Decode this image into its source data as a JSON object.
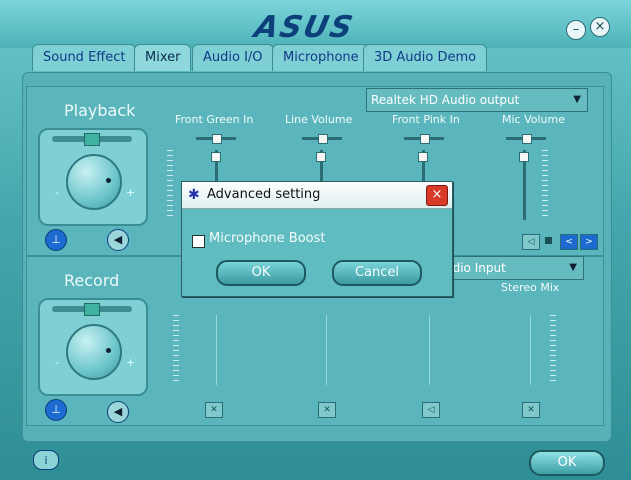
{
  "app": {
    "brand": "ASUS",
    "accent": "#0d3f7a"
  },
  "window_controls": {
    "minimize": "–",
    "close": "×"
  },
  "tabs": [
    {
      "label": "Sound Effect"
    },
    {
      "label": "Mixer"
    },
    {
      "label": "Audio I/O"
    },
    {
      "label": "Microphone"
    },
    {
      "label": "3D Audio Demo"
    }
  ],
  "active_tab": "Mixer",
  "playback": {
    "title": "Playback",
    "minus": "-",
    "plus": "+",
    "device": "Realtek HD Audio output",
    "channels": [
      {
        "label": "Front Green In"
      },
      {
        "label": "Line Volume"
      },
      {
        "label": "Front Pink In"
      },
      {
        "label": "Mic Volume"
      }
    ]
  },
  "record": {
    "title": "Record",
    "minus": "-",
    "plus": "+",
    "device": "udio Input",
    "sublabel": "Stereo Mix"
  },
  "nav": {
    "prev": "<",
    "next": ">"
  },
  "bottom": {
    "ok_label": "OK",
    "info_icon": "i"
  },
  "dialog": {
    "title": "Advanced setting",
    "checkbox_label": "Microphone Boost",
    "ok_label": "OK",
    "cancel_label": "Cancel",
    "close_label": "×"
  }
}
